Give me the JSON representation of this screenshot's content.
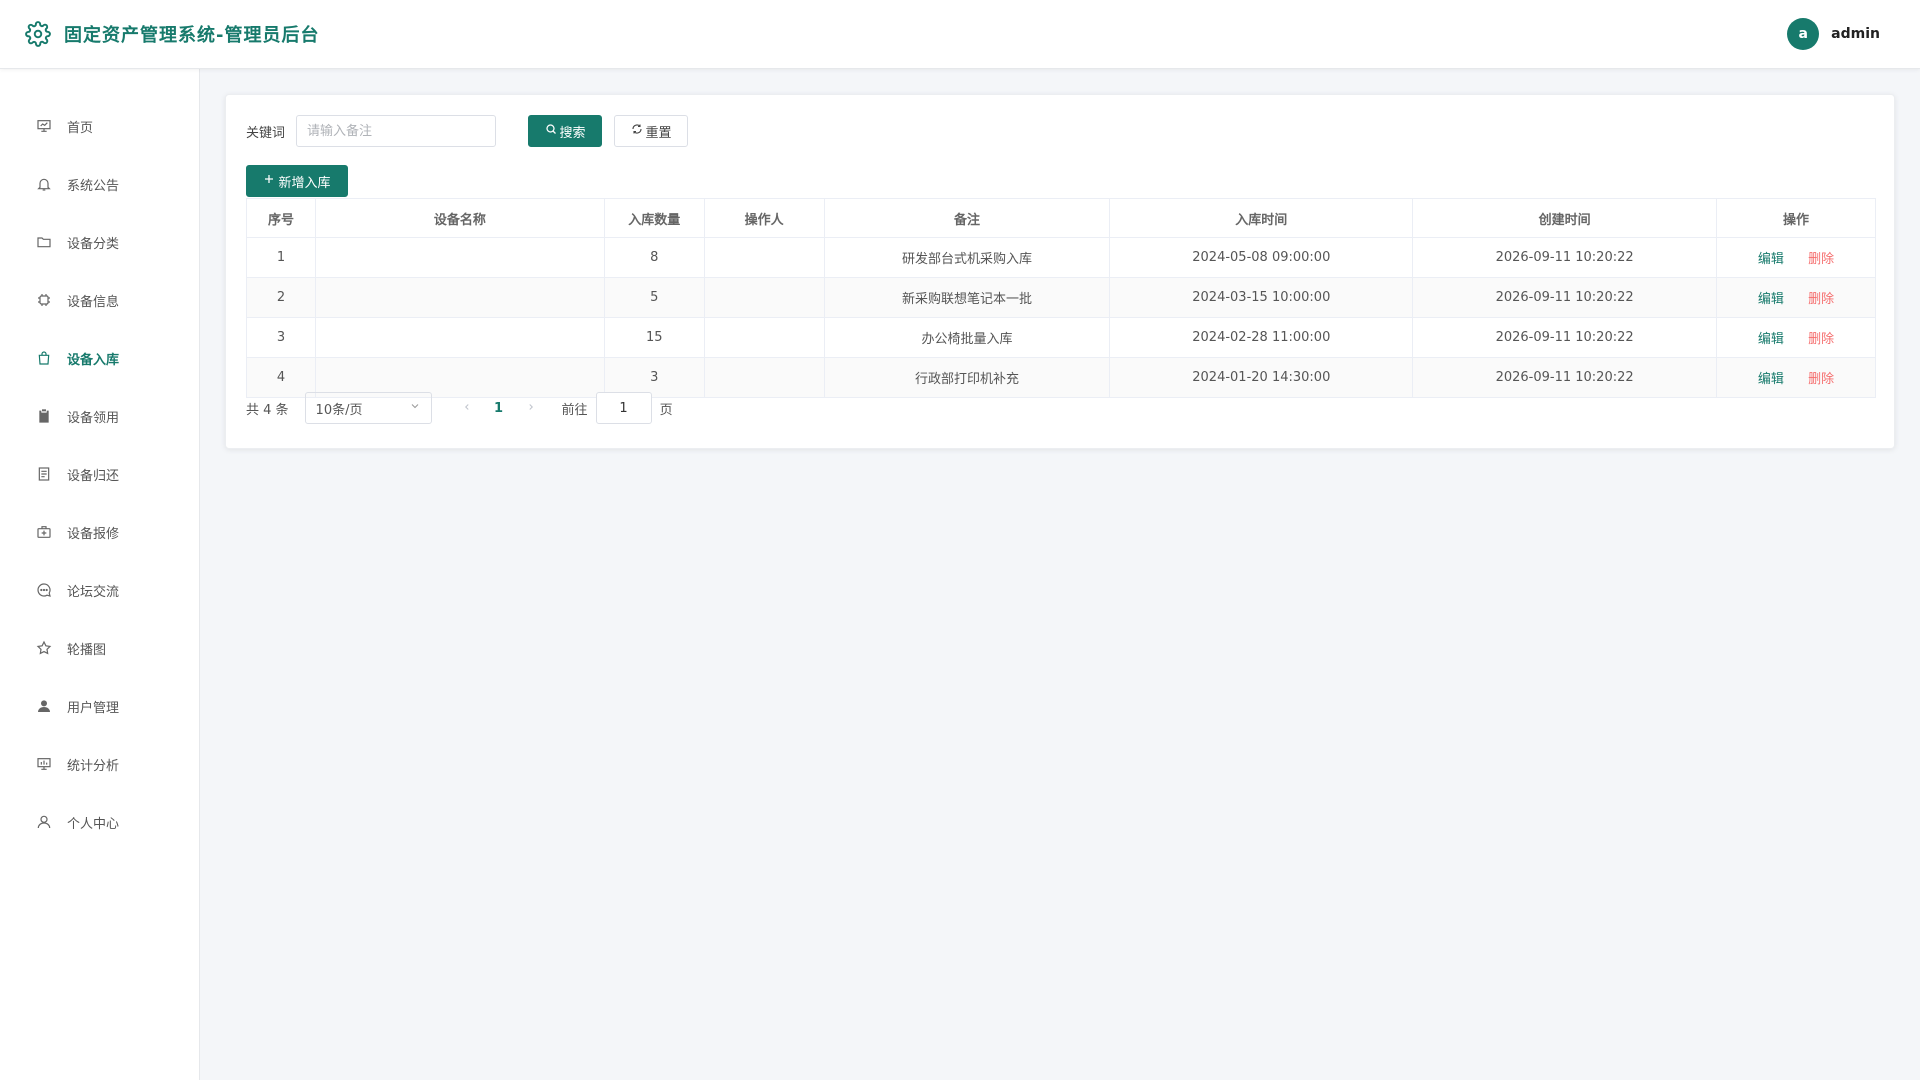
{
  "header": {
    "title": "固定资产管理系统-管理员后台",
    "user_avatar": "a",
    "user_name": "admin",
    "accent_color": "#177a6c"
  },
  "sidebar": {
    "items": [
      {
        "label": "首页",
        "icon": "presentation-icon",
        "active": false
      },
      {
        "label": "系统公告",
        "icon": "bell-icon",
        "active": false
      },
      {
        "label": "设备分类",
        "icon": "folder-icon",
        "active": false
      },
      {
        "label": "设备信息",
        "icon": "chip-icon",
        "active": false
      },
      {
        "label": "设备入库",
        "icon": "shopping-bag-icon",
        "active": true
      },
      {
        "label": "设备领用",
        "icon": "clipboard-icon",
        "active": false
      },
      {
        "label": "设备归还",
        "icon": "document-icon",
        "active": false
      },
      {
        "label": "设备报修",
        "icon": "first-aid-kit-icon",
        "active": false
      },
      {
        "label": "论坛交流",
        "icon": "chat-icon",
        "active": false
      },
      {
        "label": "轮播图",
        "icon": "star-icon",
        "active": false
      },
      {
        "label": "用户管理",
        "icon": "user-filled-icon",
        "active": false
      },
      {
        "label": "统计分析",
        "icon": "chart-board-icon",
        "active": false
      },
      {
        "label": "个人中心",
        "icon": "user-outline-icon",
        "active": false
      }
    ]
  },
  "search": {
    "label": "关键词",
    "placeholder": "请输入备注",
    "value": "",
    "search_label": "搜索",
    "reset_label": "重置"
  },
  "toolbar": {
    "add_label": "新增入库"
  },
  "table": {
    "columns": [
      "序号",
      "设备名称",
      "入库数量",
      "操作人",
      "备注",
      "入库时间",
      "创建时间",
      "操作"
    ],
    "rows": [
      {
        "index": "1",
        "device": "",
        "qty": "8",
        "operator": "",
        "note": "研发部台式机采购入库",
        "in_time": "2024-05-08 09:00:00",
        "created": "2026-09-11 10:20:22"
      },
      {
        "index": "2",
        "device": "",
        "qty": "5",
        "operator": "",
        "note": "新采购联想笔记本一批",
        "in_time": "2024-03-15 10:00:00",
        "created": "2026-09-11 10:20:22"
      },
      {
        "index": "3",
        "device": "",
        "qty": "15",
        "operator": "",
        "note": "办公椅批量入库",
        "in_time": "2024-02-28 11:00:00",
        "created": "2026-09-11 10:20:22"
      },
      {
        "index": "4",
        "device": "",
        "qty": "3",
        "operator": "",
        "note": "行政部打印机补充",
        "in_time": "2024-01-20 14:30:00",
        "created": "2026-09-11 10:20:22"
      }
    ],
    "edit_label": "编辑",
    "delete_label": "删除"
  },
  "pager": {
    "total_text": "共 4 条",
    "page_size": "10条/页",
    "current_page": "1",
    "goto_label": "前往",
    "goto_value": "1",
    "page_suffix": "页"
  }
}
